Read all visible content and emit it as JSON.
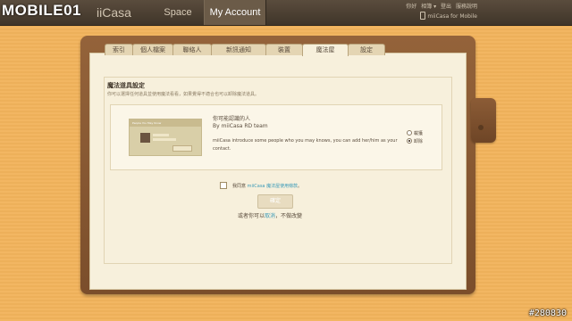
{
  "brand": {
    "logo_text": "MOBILE01",
    "watermark": "#280830"
  },
  "header": {
    "app_logo": "iiCasa",
    "nav": {
      "space": "Space",
      "my_account": "My Account"
    },
    "links": [
      "你好",
      "相簿 ▾",
      "登出",
      "服務說明"
    ],
    "mobile_link": "miiCasa for Mobile"
  },
  "tabs": [
    "索引",
    "個人檔案",
    "聯絡人",
    "新訊通知",
    "裝置",
    "魔法屋",
    "設定"
  ],
  "section": {
    "title": "魔法道具設定",
    "description": "你可以選擇任何道具並使用魔法看看，如果覺得不適合也可以卸除魔法道具。"
  },
  "app_card": {
    "thumb_title": "People You May Know",
    "thumb_lines": [
      "Name Here",
      "10 mutual friends"
    ],
    "thumb_button": "Add as Contact",
    "title": "你可能認識的人",
    "author": "By miiCasa RD team",
    "description": "miiCasa introduce some people who you may knows, you can add her/him as your contact.",
    "options": [
      {
        "label": "載獲",
        "selected": false
      },
      {
        "label": "卸除",
        "selected": true
      }
    ]
  },
  "agreement": {
    "prefix": "我同意",
    "link": "miiCasa 魔法屋使用條款",
    "suffix": "。",
    "checked": false
  },
  "buttons": {
    "confirm": "確定"
  },
  "cancel_line": {
    "prefix": "或者你可以",
    "link": "取消",
    "suffix": "，不做改變"
  }
}
